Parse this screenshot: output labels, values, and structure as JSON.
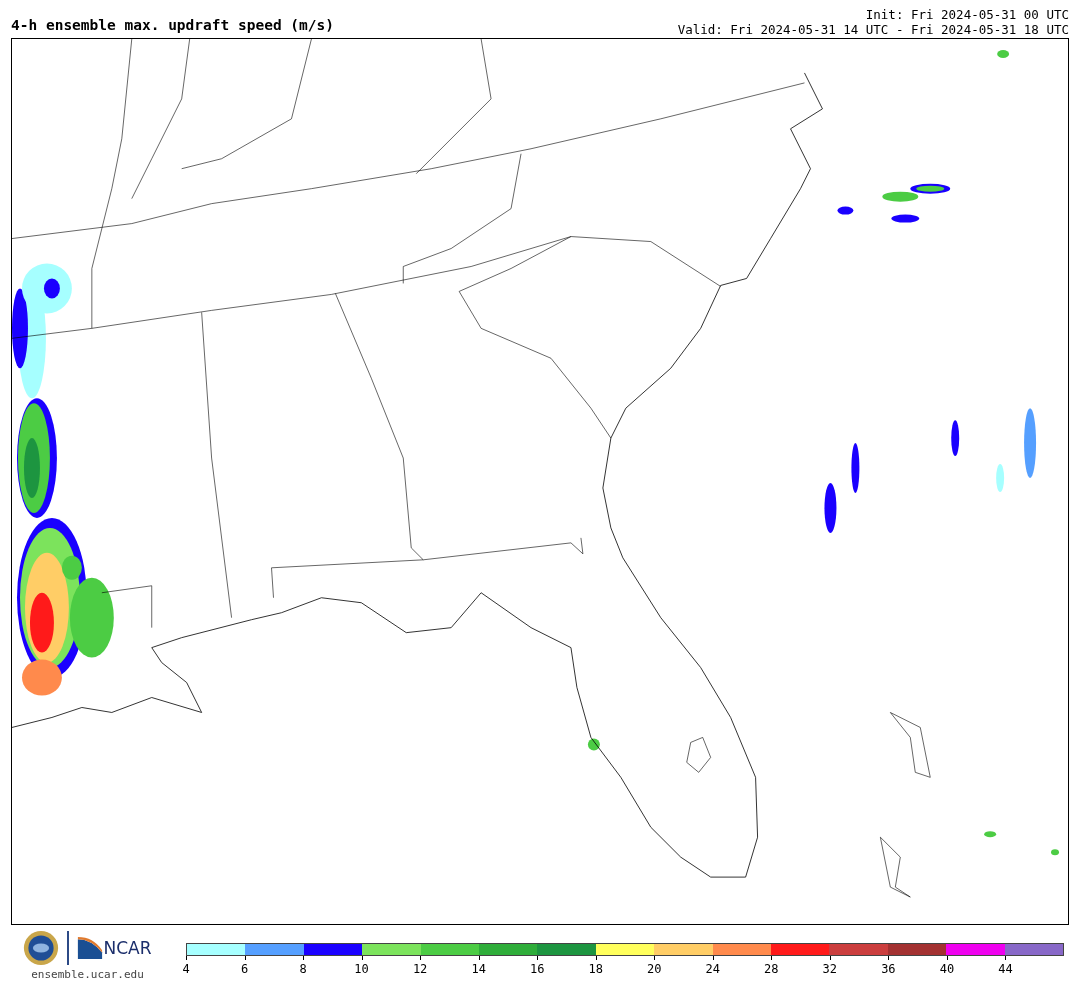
{
  "title": "4-h ensemble max. updraft speed (m/s)",
  "init": "Init: Fri 2024-05-31 00 UTC",
  "valid": "Valid: Fri 2024-05-31 14 UTC - Fri 2024-05-31 18 UTC",
  "footer": {
    "logo_text": "NCAR",
    "site": "ensemble.ucar.edu"
  },
  "colorbar": {
    "bins": [
      {
        "color": "#a6ffff"
      },
      {
        "color": "#559fff"
      },
      {
        "color": "#1a00ff"
      },
      {
        "color": "#7ce35c"
      },
      {
        "color": "#4ccc44"
      },
      {
        "color": "#2fad3a"
      },
      {
        "color": "#1d9540"
      },
      {
        "color": "#ffff5c"
      },
      {
        "color": "#ffcd66"
      },
      {
        "color": "#ff8a4c"
      },
      {
        "color": "#ff1a1a"
      },
      {
        "color": "#cb3e3e"
      },
      {
        "color": "#a33131"
      },
      {
        "color": "#ef00ef"
      },
      {
        "color": "#8868c8"
      }
    ],
    "ticks": [
      "4",
      "6",
      "8",
      "10",
      "12",
      "14",
      "16",
      "18",
      "20",
      "24",
      "28",
      "32",
      "36",
      "40",
      "44"
    ]
  }
}
